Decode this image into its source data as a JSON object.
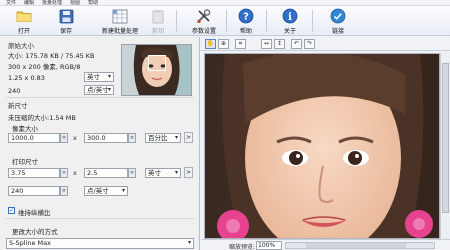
{
  "menubar": {
    "items": [
      "文件",
      "编辑",
      "批量处理",
      "视图",
      "帮助"
    ]
  },
  "toolbar": {
    "open": "打开",
    "save": "保存",
    "new_batch": "新建批量处理",
    "crop": "剪切",
    "settings": "参数设置",
    "help": "帮助",
    "about": "关于",
    "link": "链接"
  },
  "original": {
    "title": "原始大小",
    "size_line": "大小: 175.78 KB / 75.45 KB",
    "pixels_line": "300 x 200 像素, RGB/8",
    "dims_value": "1.25 x 0.83",
    "dims_unit": "英寸",
    "res_value": "240",
    "res_unit": "点/英寸"
  },
  "newsize": {
    "title": "新尺寸",
    "uncompressed": "未压缩的大小:1.54 MB",
    "pixel_size_label": "像素大小",
    "px_width": "1000.0",
    "px_height": "300.0",
    "px_unit": "百分比",
    "print_size_label": "打印尺寸",
    "print_width": "3.75",
    "print_height": "2.5",
    "print_unit": "英寸",
    "print_res": "240",
    "print_res_unit": "点/英寸",
    "keep_ratio": "维持纵横比",
    "times_sign": "x",
    "more_btn": ">"
  },
  "method": {
    "title": "更改大小的方式",
    "value": "S-Spline Max"
  },
  "status": {
    "zoom_label": "缩放预览:",
    "zoom_value": "100%"
  },
  "colors": {
    "toolbar_bg": "#eef2f8",
    "accent": "#1b6ec2",
    "panel_bg": "#f0f0f0"
  }
}
